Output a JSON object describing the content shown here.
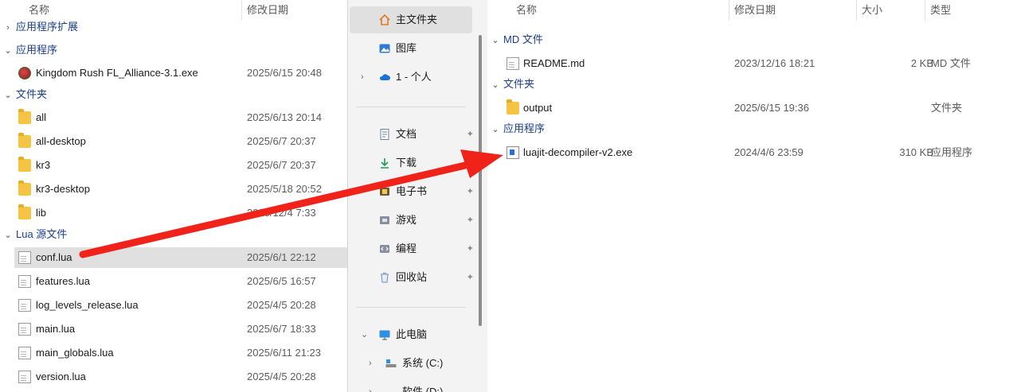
{
  "left": {
    "columns": {
      "name": "名称",
      "modified": "修改日期"
    },
    "groups": {
      "app_ext": "应用程序扩展",
      "apps": "应用程序",
      "folders": "文件夹",
      "lua": "Lua 源文件"
    },
    "apps": [
      {
        "name": "Kingdom Rush FL_Alliance-3.1.exe",
        "date": "2025/6/15 20:48"
      }
    ],
    "folders": [
      {
        "name": "all",
        "date": "2025/6/13 20:14"
      },
      {
        "name": "all-desktop",
        "date": "2025/6/7 20:37"
      },
      {
        "name": "kr3",
        "date": "2025/6/7 20:37"
      },
      {
        "name": "kr3-desktop",
        "date": "2025/5/18 20:52"
      },
      {
        "name": "lib",
        "date": "2025/12/4 7:33"
      }
    ],
    "lua_files": [
      {
        "name": "conf.lua",
        "date": "2025/6/1 22:12"
      },
      {
        "name": "features.lua",
        "date": "2025/6/5 16:57"
      },
      {
        "name": "log_levels_release.lua",
        "date": "2025/4/5 20:28"
      },
      {
        "name": "main.lua",
        "date": "2025/6/7 18:33"
      },
      {
        "name": "main_globals.lua",
        "date": "2025/6/11 21:23"
      },
      {
        "name": "version.lua",
        "date": "2025/4/5 20:28"
      }
    ]
  },
  "nav": {
    "home": "主文件夹",
    "gallery": "图库",
    "onedrive": "1 - 个人",
    "documents": "文档",
    "downloads": "下载",
    "ebooks": "电子书",
    "games": "游戏",
    "programming": "编程",
    "recycle": "回收站",
    "this_pc": "此电脑",
    "drive_c": "系统 (C:)",
    "drive_d": "软件 (D:)"
  },
  "right": {
    "columns": {
      "name": "名称",
      "modified": "修改日期",
      "size": "大小",
      "type": "类型"
    },
    "groups": {
      "md": "MD 文件",
      "folders": "文件夹",
      "apps": "应用程序"
    },
    "md_files": [
      {
        "name": "README.md",
        "date": "2023/12/16 18:21",
        "size": "2 KB",
        "type": "MD 文件"
      }
    ],
    "folders": [
      {
        "name": "output",
        "date": "2025/6/15 19:36",
        "size": "",
        "type": "文件夹"
      }
    ],
    "apps": [
      {
        "name": "luajit-decompiler-v2.exe",
        "date": "2024/4/6 23:59",
        "size": "310 KB",
        "type": "应用程序"
      }
    ]
  },
  "colors": {
    "arrow": "#f0231a",
    "selection": "#e0e0e0",
    "group_text": "#1a3e8c"
  },
  "icons": {
    "folder": "folder-icon",
    "file": "document-icon",
    "exe": "exe-icon",
    "home": "home-icon",
    "gallery": "gallery-icon",
    "cloud": "cloud-icon",
    "pin": "pin-icon",
    "pc": "pc-icon",
    "drive": "drive-icon"
  }
}
